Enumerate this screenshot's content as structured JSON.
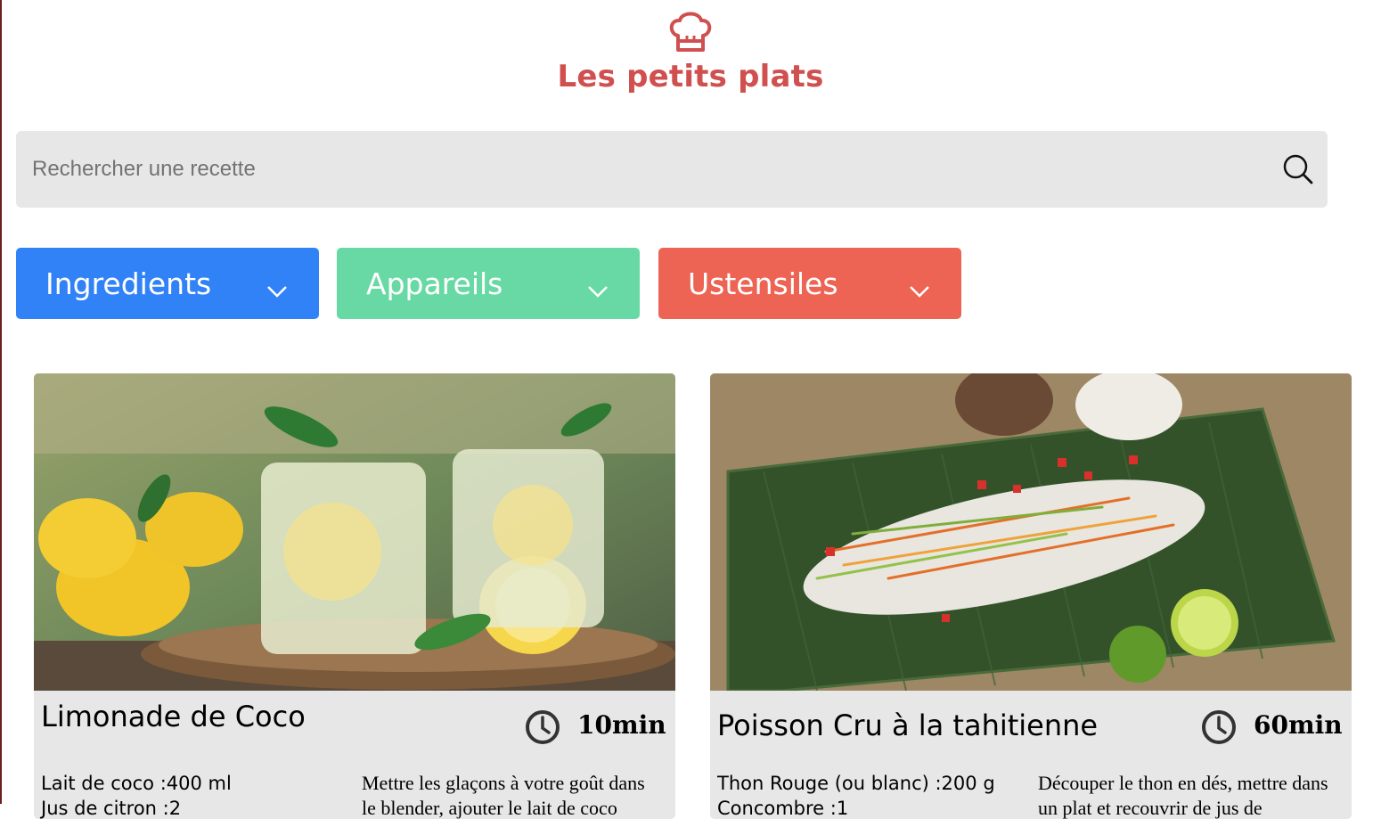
{
  "header": {
    "title": "Les petits plats",
    "logo_icon": "chef-hat-icon",
    "brand_color": "#D04F4F"
  },
  "search": {
    "placeholder": "Rechercher une recette",
    "value": "",
    "icon": "search-icon"
  },
  "filters": [
    {
      "label": "Ingredients",
      "color": "#3282F7",
      "icon": "chevron-down-icon"
    },
    {
      "label": "Appareils",
      "color": "#68D9A4",
      "icon": "chevron-down-icon"
    },
    {
      "label": "Ustensiles",
      "color": "#ED6454",
      "icon": "chevron-down-icon"
    }
  ],
  "recipes": [
    {
      "title": "Limonade de Coco",
      "time": "10min",
      "ingredients": [
        "Lait de coco :400 ml",
        "Jus de citron :2"
      ],
      "description": "Mettre les glaçons à votre goût dans le blender, ajouter le lait de coco"
    },
    {
      "title": "Poisson Cru à la tahitienne",
      "time": "60min",
      "ingredients": [
        "Thon Rouge (ou blanc) :200 g",
        "Concombre :1"
      ],
      "description": "Découper le thon en dés, mettre dans un plat et recouvrir de jus de"
    }
  ],
  "colors": {
    "card_bg": "#E7E7E7",
    "search_bg": "#E7E7E7"
  }
}
